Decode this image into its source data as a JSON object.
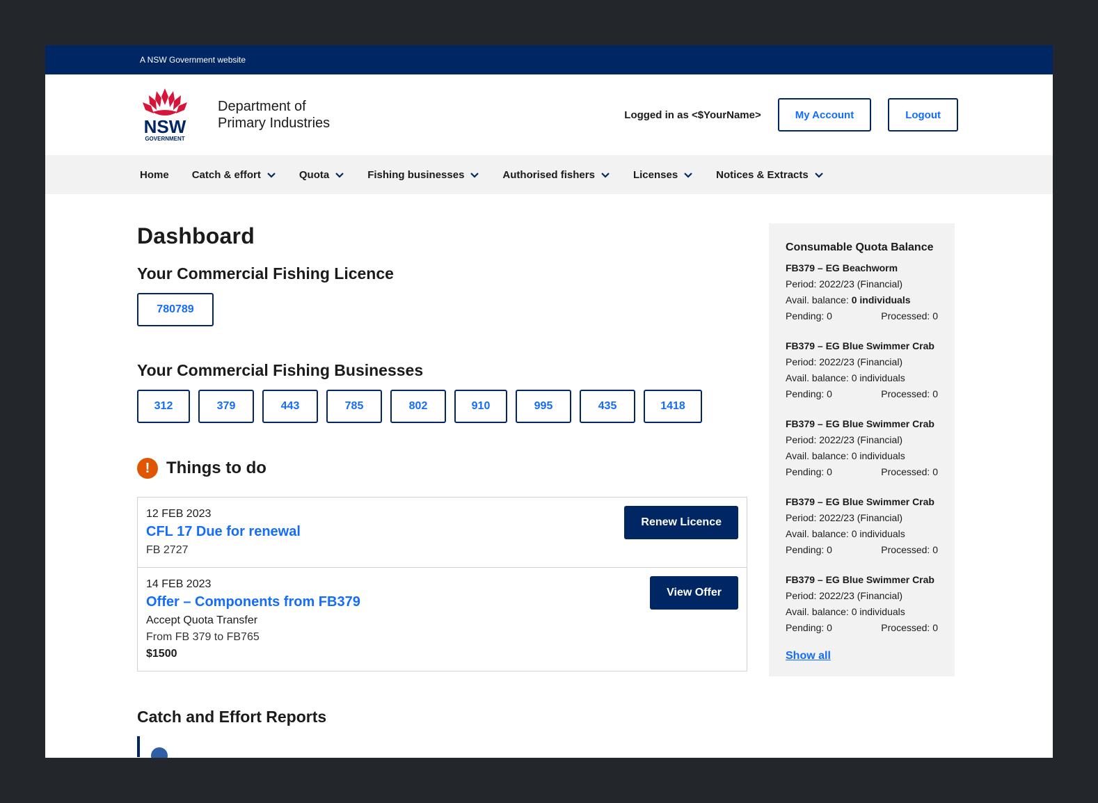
{
  "masthead": {
    "text": "A NSW Government website"
  },
  "header": {
    "logo_wordmark": "NSW",
    "logo_sub": "GOVERNMENT",
    "department_line1": "Department of",
    "department_line2": "Primary Industries",
    "logged_in": "Logged in as <$YourName>",
    "my_account": "My Account",
    "logout": "Logout"
  },
  "nav": {
    "items": [
      {
        "label": "Home",
        "has_menu": false
      },
      {
        "label": "Catch & effort",
        "has_menu": true
      },
      {
        "label": "Quota",
        "has_menu": true
      },
      {
        "label": "Fishing businesses",
        "has_menu": true
      },
      {
        "label": "Authorised fishers",
        "has_menu": true
      },
      {
        "label": "Licenses",
        "has_menu": true
      },
      {
        "label": "Notices & Extracts",
        "has_menu": true
      }
    ]
  },
  "main": {
    "title": "Dashboard",
    "licence_heading": "Your Commercial Fishing Licence",
    "licence_number": "780789",
    "businesses_heading": "Your Commercial Fishing Businesses",
    "businesses": [
      "312",
      "379",
      "443",
      "785",
      "802",
      "910",
      "995",
      "435",
      "1418"
    ],
    "todo_heading": "Things to do",
    "todo_icon": "!",
    "todos": [
      {
        "date": "12 FEB 2023",
        "title": "CFL 17 Due for renewal",
        "line1": "FB 2727",
        "button": "Renew Licence"
      },
      {
        "date": "14 FEB 2023",
        "title": "Offer – Components from FB379",
        "line1": "Accept Quota Transfer",
        "line2": "From FB 379 to FB765",
        "amount": "$1500",
        "button": "View Offer"
      }
    ],
    "reports_heading": "Catch and Effort Reports"
  },
  "sidebar": {
    "title": "Consumable Quota Balance",
    "items": [
      {
        "name": "FB379 – EG Beachworm",
        "period": "Period: 2022/23 (Financial)",
        "balance_label": "Avail. balance: ",
        "balance_value": "0 individuals",
        "balance_bold": true,
        "pending": "Pending: 0",
        "processed": "Processed: 0"
      },
      {
        "name": "FB379 – EG Blue Swimmer Crab",
        "period": "Period: 2022/23 (Financial)",
        "balance_label": "Avail. balance: ",
        "balance_value": "0 individuals",
        "balance_bold": false,
        "pending": "Pending: 0",
        "processed": "Processed: 0"
      },
      {
        "name": "FB379 – EG Blue Swimmer Crab",
        "period": "Period: 2022/23 (Financial)",
        "balance_label": "Avail. balance: ",
        "balance_value": "0 individuals",
        "balance_bold": false,
        "pending": "Pending: 0",
        "processed": "Processed: 0"
      },
      {
        "name": "FB379 – EG Blue Swimmer Crab",
        "period": "Period: 2022/23 (Financial)",
        "balance_label": "Avail. balance: ",
        "balance_value": "0 individuals",
        "balance_bold": false,
        "pending": "Pending: 0",
        "processed": "Processed: 0"
      },
      {
        "name": "FB379 – EG Blue Swimmer Crab",
        "period": "Period: 2022/23 (Financial)",
        "balance_label": "Avail. balance: ",
        "balance_value": "0 individuals",
        "balance_bold": false,
        "pending": "Pending: 0",
        "processed": "Processed: 0"
      }
    ],
    "show_all": "Show all"
  },
  "colors": {
    "navy": "#002664",
    "link_blue": "#146cfd",
    "alert_orange": "#e05500",
    "nsw_red": "#d7153a",
    "panel_grey": "#f2f2f2"
  }
}
